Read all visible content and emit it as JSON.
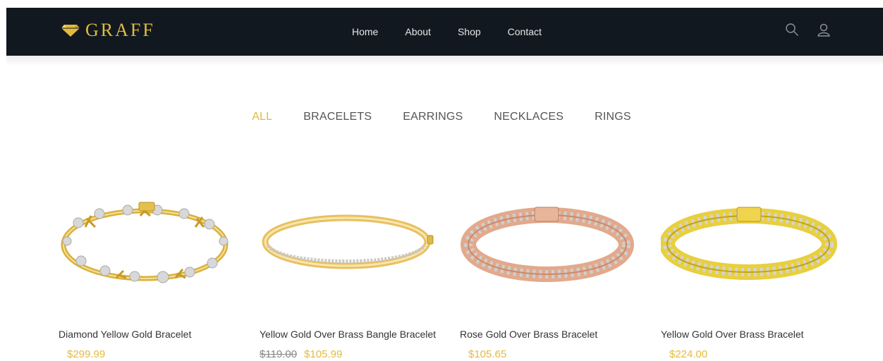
{
  "brand": {
    "name": "GRAFF",
    "color": "#e2bb3f"
  },
  "nav": {
    "links": [
      "Home",
      "About",
      "Shop",
      "Contact"
    ],
    "icons": [
      "search-icon",
      "user-icon"
    ]
  },
  "filters": {
    "active": "ALL",
    "items": [
      "ALL",
      "BRACELETS",
      "EARRINGS",
      "NECKLACES",
      "RINGS"
    ]
  },
  "products": [
    {
      "name": "Diamond Yellow Gold Bracelet",
      "old_price": "",
      "price": "$299.99",
      "metal": "yellow gold"
    },
    {
      "name": "Yellow Gold Over Brass Bangle Bracelet",
      "old_price": "$119.00",
      "price": "$105.99",
      "metal": "yellow gold"
    },
    {
      "name": "Rose Gold Over Brass Bracelet",
      "old_price": "",
      "price": "$105.65",
      "metal": "rose gold"
    },
    {
      "name": "Yellow Gold Over Brass Bracelet",
      "old_price": "",
      "price": "$224.00",
      "metal": "yellow gold"
    }
  ]
}
